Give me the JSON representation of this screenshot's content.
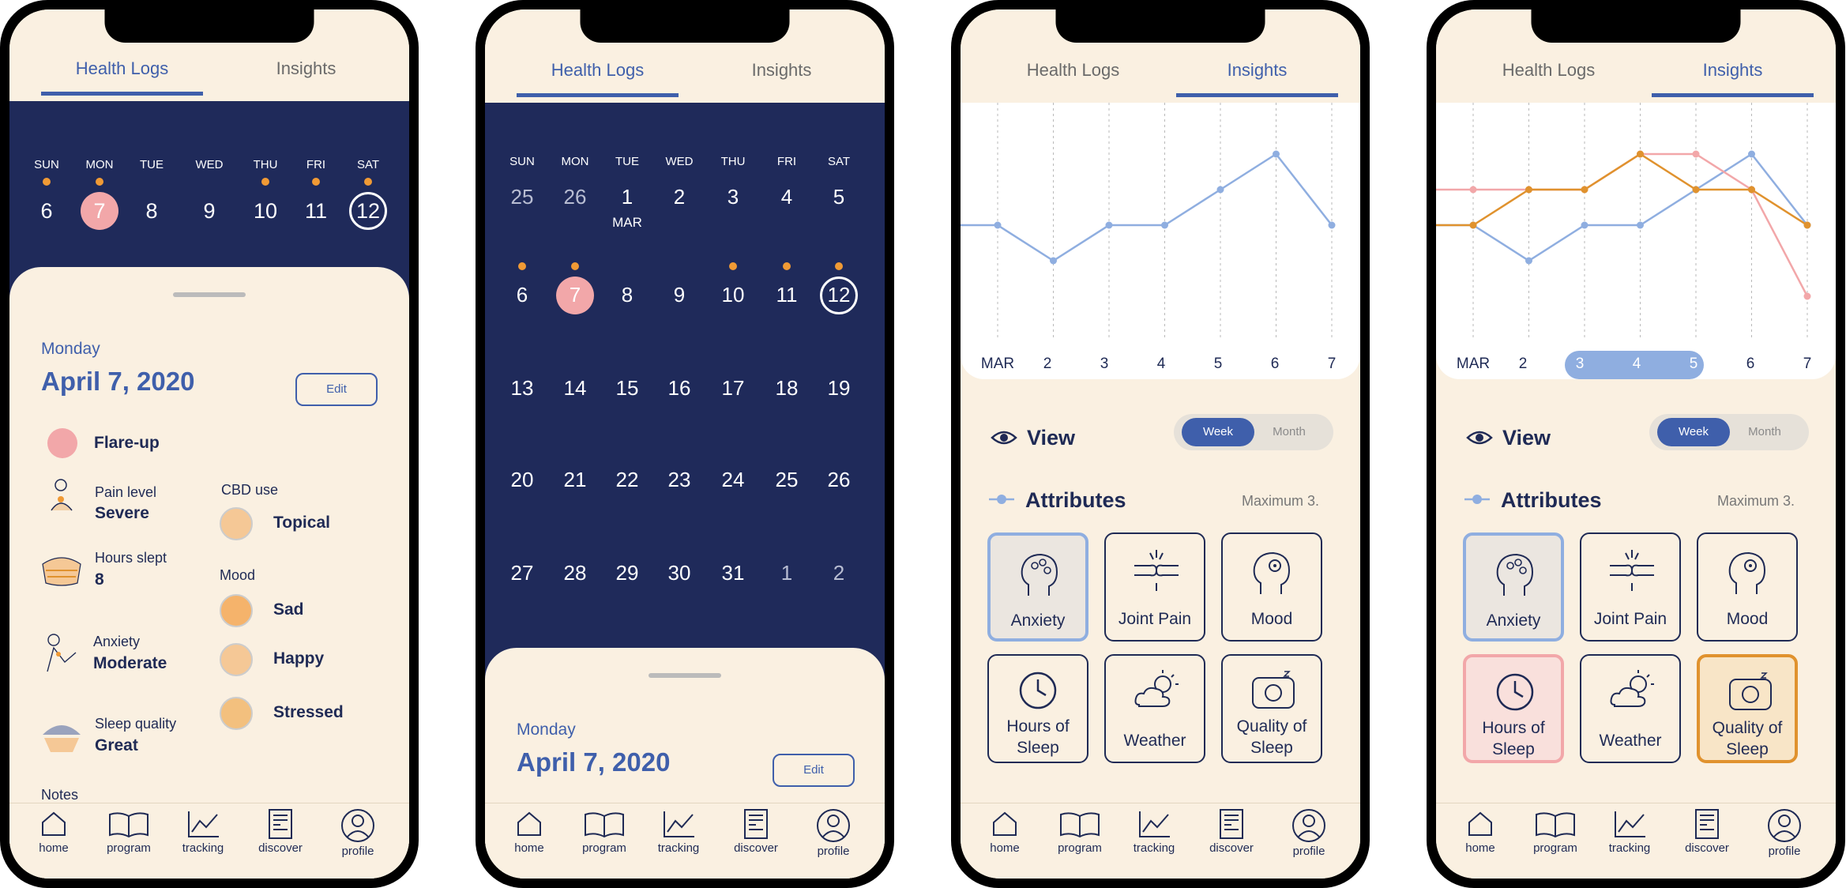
{
  "tabs": {
    "health_logs": "Health Logs",
    "insights": "Insights"
  },
  "weekdays": [
    "SUN",
    "MON",
    "TUE",
    "WED",
    "THU",
    "FRI",
    "SAT"
  ],
  "week_dates": [
    "6",
    "7",
    "8",
    "9",
    "10",
    "11",
    "12"
  ],
  "screen1": {
    "weekday": "Monday",
    "date": "April 7, 2020",
    "edit": "Edit",
    "flare": "Flare-up",
    "pain_label": "Pain level",
    "pain_value": "Severe",
    "cbd_label": "CBD use",
    "cbd_value": "Topical",
    "hours_label": "Hours slept",
    "hours_value": "8",
    "mood_label": "Mood",
    "mood_sad": "Sad",
    "mood_happy": "Happy",
    "mood_stressed": "Stressed",
    "anx_label": "Anxiety",
    "anx_value": "Moderate",
    "sleepq_label": "Sleep quality",
    "sleepq_value": "Great",
    "notes": "Notes"
  },
  "month": {
    "label": "MAR",
    "rows": [
      [
        "25",
        "26",
        "1",
        "2",
        "3",
        "4",
        "5"
      ],
      [
        "6",
        "7",
        "8",
        "9",
        "10",
        "11",
        "12"
      ],
      [
        "13",
        "14",
        "15",
        "16",
        "17",
        "18",
        "19"
      ],
      [
        "20",
        "21",
        "22",
        "23",
        "24",
        "25",
        "26"
      ],
      [
        "27",
        "28",
        "29",
        "30",
        "31",
        "1",
        "2"
      ]
    ]
  },
  "screen2": {
    "weekday": "Monday",
    "date": "April 7, 2020",
    "edit": "Edit"
  },
  "insights": {
    "view": "View",
    "week": "Week",
    "month": "Month",
    "attributes": "Attributes",
    "maximum": "Maximum 3.",
    "tiles": [
      "Anxiety",
      "Joint Pain",
      "Mood",
      "Hours of",
      "Sleep",
      "Weather",
      "Quality of",
      "Sleep"
    ]
  },
  "nav": [
    "home",
    "program",
    "tracking",
    "discover",
    "profile"
  ],
  "chart_data": [
    {
      "type": "line",
      "categories": [
        "MAR",
        "2",
        "3",
        "4",
        "5",
        "6",
        "7"
      ],
      "series": [
        {
          "name": "Anxiety",
          "color": "#8faee0",
          "values": [
            3,
            2,
            3,
            3,
            4,
            5,
            3
          ]
        }
      ],
      "ylim": [
        0,
        6
      ]
    },
    {
      "type": "line",
      "categories": [
        "MAR",
        "2",
        "3",
        "4",
        "5",
        "6",
        "7"
      ],
      "highlight_range": [
        "3",
        "5"
      ],
      "series": [
        {
          "name": "Anxiety",
          "color": "#8faee0",
          "values": [
            3,
            2,
            3,
            3,
            4,
            5,
            3
          ]
        },
        {
          "name": "Hours of Sleep",
          "color": "#f2a7a9",
          "values": [
            4,
            4,
            4,
            5,
            5,
            4,
            1
          ]
        },
        {
          "name": "Quality of Sleep",
          "color": "#e0922e",
          "values": [
            3,
            4,
            4,
            5,
            4,
            4,
            3
          ]
        }
      ],
      "ylim": [
        0,
        6
      ]
    }
  ],
  "colors": {
    "navy": "#1f2a5a",
    "cream": "#faf0e1",
    "accent": "#3f5fab",
    "dot": "#f09a35",
    "today": "#f2a7a9"
  }
}
